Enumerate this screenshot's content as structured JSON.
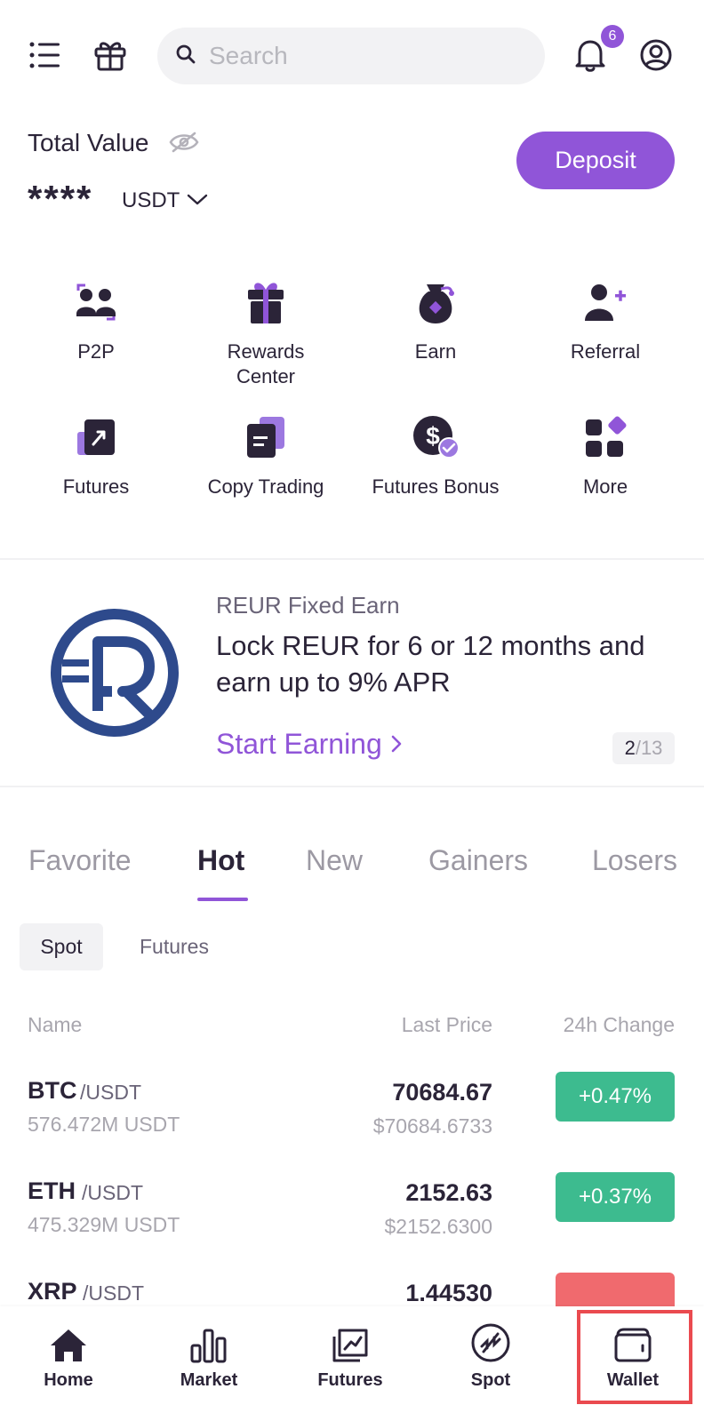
{
  "header": {
    "search_placeholder": "Search",
    "notification_count": "6"
  },
  "total_value": {
    "label": "Total Value",
    "masked_value": "****",
    "currency": "USDT",
    "deposit_label": "Deposit"
  },
  "shortcuts": [
    {
      "label": "P2P",
      "icon": "p2p-icon"
    },
    {
      "label": "Rewards Center",
      "icon": "gift-icon"
    },
    {
      "label": "Earn",
      "icon": "money-bag-icon"
    },
    {
      "label": "Referral",
      "icon": "add-user-icon"
    },
    {
      "label": "Futures",
      "icon": "futures-icon"
    },
    {
      "label": "Copy Trading",
      "icon": "copy-trading-icon"
    },
    {
      "label": "Futures Bonus",
      "icon": "dollar-coin-icon"
    },
    {
      "label": "More",
      "icon": "grid-icon"
    }
  ],
  "banner": {
    "tag": "REUR Fixed Earn",
    "title": "Lock REUR for 6 or 12 months and earn up to 9% APR",
    "cta": "Start Earning",
    "page_current": "2",
    "page_total": "/13"
  },
  "market_tabs": [
    "Favorite",
    "Hot",
    "New",
    "Gainers",
    "Losers"
  ],
  "active_tab": "Hot",
  "sub_tabs": [
    "Spot",
    "Futures"
  ],
  "columns": {
    "name": "Name",
    "last_price": "Last Price",
    "change": "24h Change"
  },
  "rows": [
    {
      "base": "BTC",
      "quote": "/USDT",
      "volume": "576.472M USDT",
      "price": "70684.67",
      "usd": "$70684.6733",
      "change": "+0.47%",
      "direction": "up"
    },
    {
      "base": "ETH",
      "quote": "/USDT",
      "volume": "475.329M USDT",
      "price": "2152.63",
      "usd": "$2152.6300",
      "change": "+0.37%",
      "direction": "up"
    },
    {
      "base": "XRP",
      "quote": "/USDT",
      "volume": "",
      "price": "1.44530",
      "usd": "",
      "change": "",
      "direction": "down"
    }
  ],
  "bottom_nav": [
    {
      "label": "Home",
      "icon": "home-icon"
    },
    {
      "label": "Market",
      "icon": "bar-chart-icon"
    },
    {
      "label": "Futures",
      "icon": "futures-chart-icon"
    },
    {
      "label": "Spot",
      "icon": "spot-icon"
    },
    {
      "label": "Wallet",
      "icon": "wallet-icon"
    }
  ],
  "colors": {
    "accent": "#9055d8",
    "up": "#3dbb8f",
    "down": "#f06a6e",
    "text": "#2b2438",
    "highlight": "#ea4a4f"
  }
}
